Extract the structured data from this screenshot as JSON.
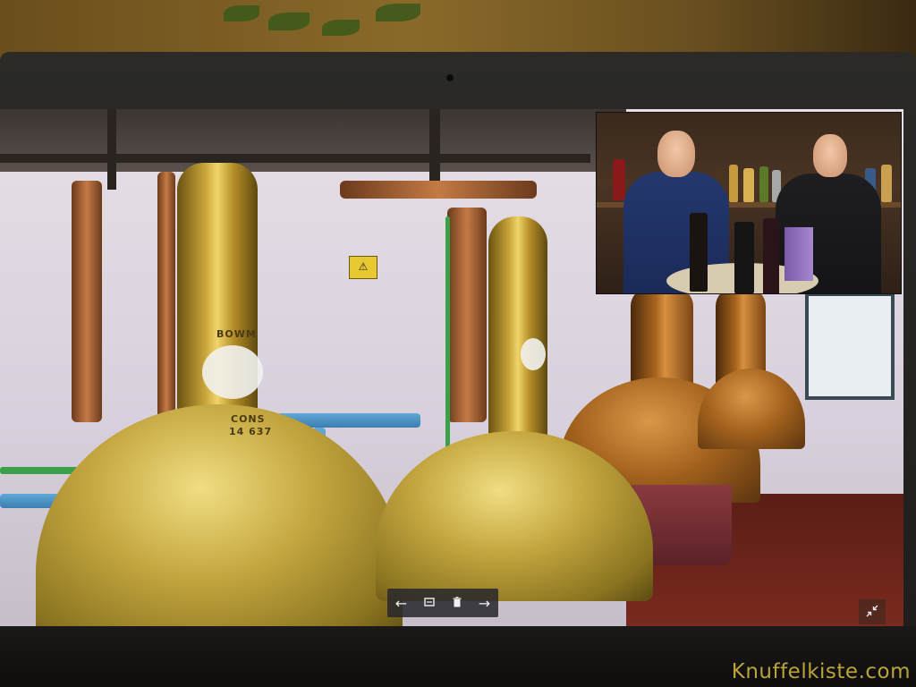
{
  "still_markings": {
    "maker": "BOWM",
    "model": "CONS",
    "number": "14 637"
  },
  "toolbar": {
    "previous_icon": "arrow-left-icon",
    "slideshow_icon": "slideshow-icon",
    "delete_icon": "trash-icon",
    "next_icon": "arrow-right-icon",
    "previous_glyph": "←",
    "next_glyph": "→"
  },
  "exit_fullscreen_icon": "compress-icon",
  "watermark": "Knuffelkiste.com",
  "colors": {
    "watermark": "#b8a43a",
    "toolbar_bg": "#28282c"
  }
}
